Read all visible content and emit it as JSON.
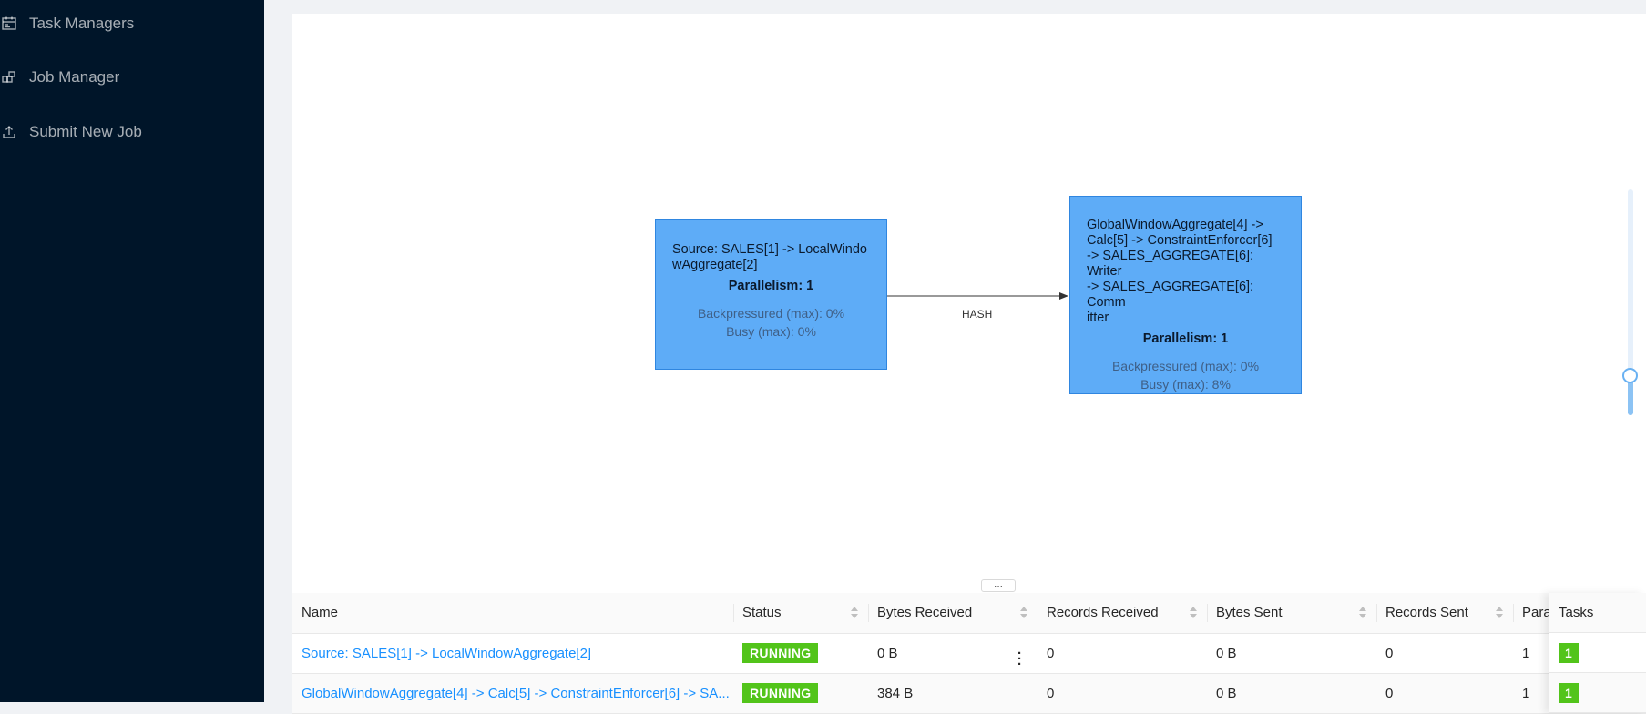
{
  "sidebar": {
    "items": [
      {
        "label": "Task Managers",
        "icon": "task-managers-icon"
      },
      {
        "label": "Job Manager",
        "icon": "job-manager-icon"
      },
      {
        "label": "Submit New Job",
        "icon": "upload-icon"
      }
    ]
  },
  "graph": {
    "nodes": [
      {
        "name": "Source: SALES[1] -> LocalWindo wAggregate[2]",
        "name_lines": [
          "Source: SALES[1] -> LocalWindo",
          "wAggregate[2]"
        ],
        "parallelism": "Parallelism: 1",
        "backpressured": "Backpressured (max): 0%",
        "busy": "Busy (max): 0%"
      },
      {
        "name_lines": [
          "GlobalWindowAggregate[4] ->",
          "Calc[5] -> ConstraintEnforcer[6]",
          "-> SALES_AGGREGATE[6]: Writer",
          "-> SALES_AGGREGATE[6]: Comm",
          "itter"
        ],
        "parallelism": "Parallelism: 1",
        "backpressured": "Backpressured (max): 0%",
        "busy": "Busy (max): 8%"
      }
    ],
    "edge_label": "HASH"
  },
  "resize_handle": "...",
  "table": {
    "columns": [
      "Name",
      "Status",
      "Bytes Received",
      "Records Received",
      "Bytes Sent",
      "Records Sent",
      "Para",
      "Tasks"
    ],
    "rows": [
      {
        "name": "Source: SALES[1] -> LocalWindowAggregate[2]",
        "status": "RUNNING",
        "bytes_received": "0 B",
        "records_received": "0",
        "bytes_sent": "0 B",
        "records_sent": "0",
        "parallelism": "1",
        "tasks": "1"
      },
      {
        "name": "GlobalWindowAggregate[4] -> Calc[5] -> ConstraintEnforcer[6] -> SA...",
        "status": "RUNNING",
        "bytes_received": "384 B",
        "records_received": "0",
        "bytes_sent": "0 B",
        "records_sent": "0",
        "parallelism": "1",
        "tasks": "1"
      }
    ]
  },
  "colors": {
    "sidebar_bg": "#001529",
    "node_bg": "#5eacf7",
    "running": "#52c41a",
    "link": "#1890ff"
  }
}
